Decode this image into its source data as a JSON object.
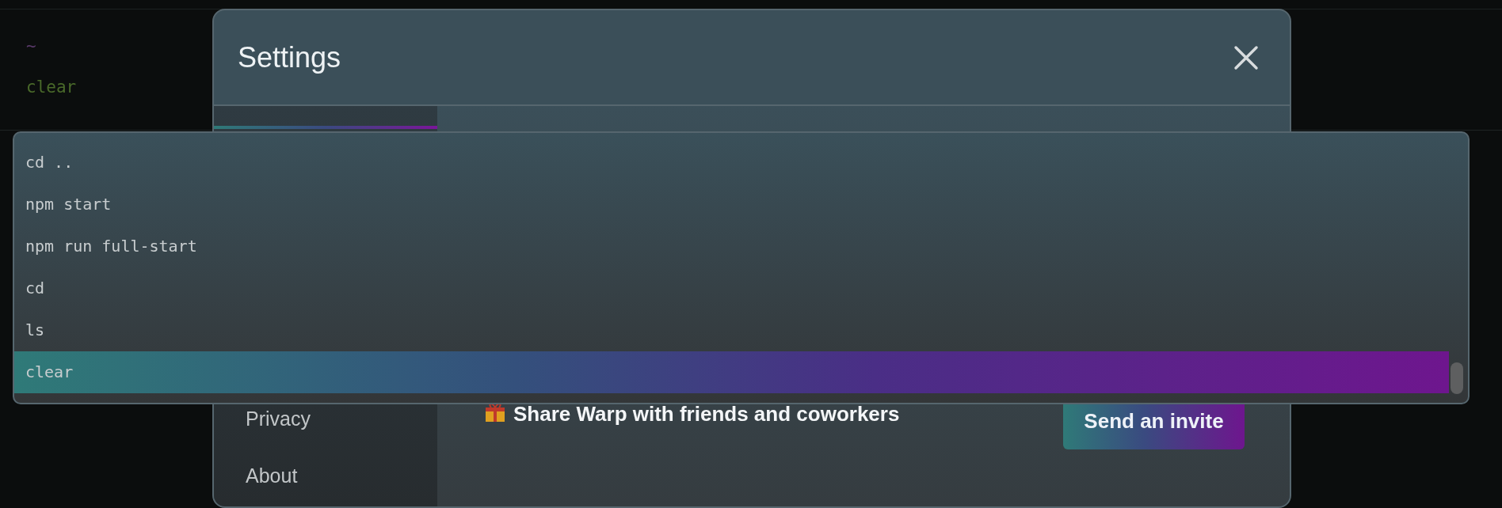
{
  "terminal": {
    "lines": [
      {
        "kind": "path",
        "text": "~"
      },
      {
        "kind": "command",
        "text": "clear"
      }
    ]
  },
  "settings_dialog": {
    "title": "Settings",
    "sidebar": {
      "items": [
        {
          "label": "Privacy",
          "selected": false
        },
        {
          "label": "About",
          "selected": false
        }
      ]
    },
    "referral": {
      "text": "Share Warp with friends and coworkers",
      "button": "Send an invite"
    }
  },
  "history_menu": {
    "items": [
      {
        "command": "cd ..",
        "selected": false
      },
      {
        "command": "npm start",
        "selected": false
      },
      {
        "command": "npm run full-start",
        "selected": false
      },
      {
        "command": "cd",
        "selected": false
      },
      {
        "command": "ls",
        "selected": false
      },
      {
        "command": "clear",
        "selected": true
      }
    ]
  }
}
